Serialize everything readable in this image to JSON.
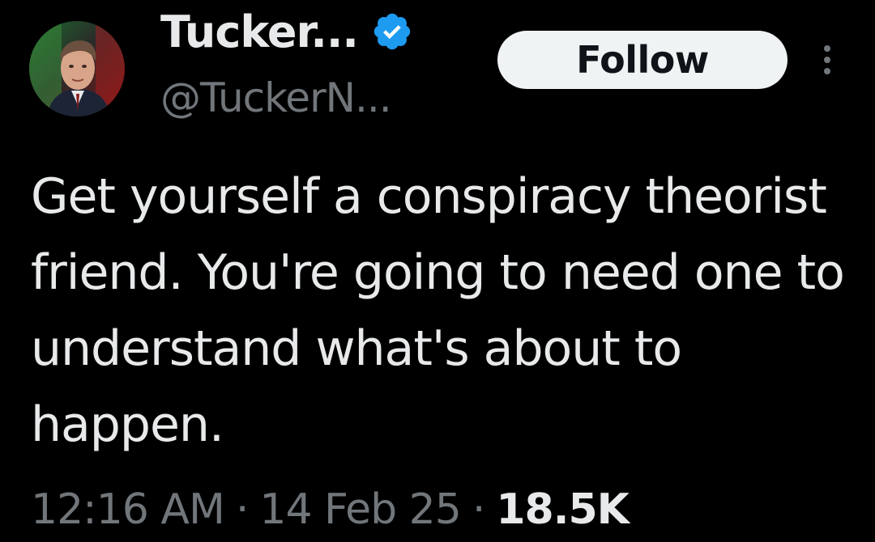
{
  "author": {
    "display_name": "Tucker...",
    "handle": "@TuckerN...",
    "verified_icon": "verified-badge-icon",
    "avatar_icon": "profile-photo"
  },
  "actions": {
    "follow_label": "Follow",
    "more_icon": "more-options-icon"
  },
  "tweet": {
    "text": "Get yourself a conspiracy theorist friend. You're going to need one to understand what's about to happen."
  },
  "meta": {
    "time": "12:16 AM",
    "separator": "·",
    "date": "14 Feb 25",
    "views": "18.5K"
  },
  "colors": {
    "background": "#000000",
    "primary_text": "#e7e9ea",
    "secondary_text": "#71767b",
    "verified_blue": "#1d9bf0",
    "follow_button_bg": "#eff3f4"
  }
}
